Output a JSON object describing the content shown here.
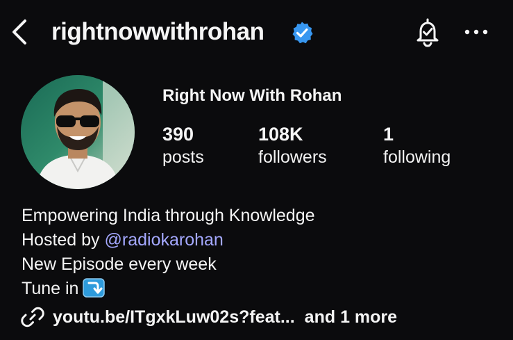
{
  "header": {
    "username": "rightnowwithrohan",
    "back_icon": "chevron-left-icon",
    "verified_icon": "verified-badge-icon",
    "bell_icon": "bell-check-icon",
    "more_icon": "more-horizontal-icon"
  },
  "profile": {
    "display_name": "Right Now With Rohan",
    "avatar": "avatar-photo",
    "stats": {
      "posts": {
        "value": "390",
        "label": "posts"
      },
      "followers": {
        "value": "108K",
        "label": "followers"
      },
      "following": {
        "value": "1",
        "label": "following"
      }
    }
  },
  "bio": {
    "line1": "Empowering India through Knowledge",
    "line2_prefix": "Hosted by ",
    "line2_mention": "@radiokarohan",
    "line3": "New Episode every week",
    "line4": "Tune in",
    "line4_icon": "arrow-down-right-icon"
  },
  "links": {
    "icon": "link-icon",
    "url": "youtu.be/ITgxkLuw02s?feat...",
    "more": "and 1 more"
  },
  "colors": {
    "background": "#0b0b0d",
    "text": "#f5f5f5",
    "verified": "#3897f0",
    "mention": "#a4a8ff",
    "tune_icon_bg": "#2e9bdc"
  }
}
